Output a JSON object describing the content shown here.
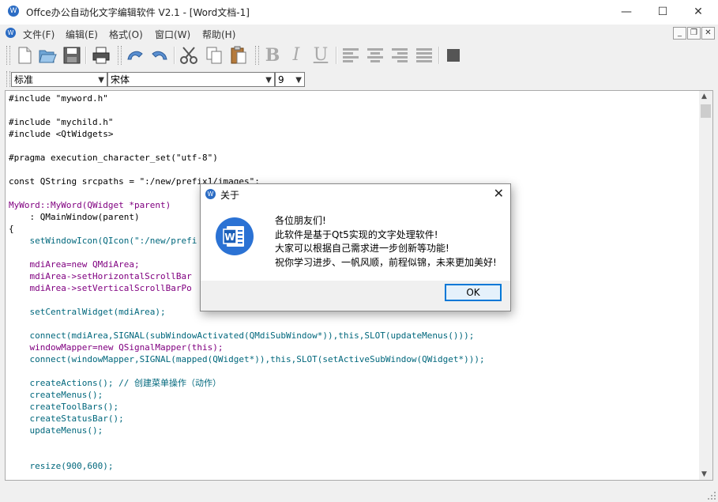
{
  "window": {
    "title": "Offce办公自动化文字编辑软件 V2.1 - [Word文档-1]",
    "minimize": "—",
    "maximize": "☐",
    "close": "✕",
    "app_icon": "app-logo-icon"
  },
  "menubar": {
    "items": [
      "文件(F)",
      "编辑(E)",
      "格式(O)",
      "窗口(W)",
      "帮助(H)"
    ],
    "mdi_min": "_",
    "mdi_restore": "❐",
    "mdi_close": "✕"
  },
  "toolbar": {
    "buttons": [
      "new-file-icon",
      "open-file-icon",
      "save-icon",
      "print-icon",
      "undo-icon",
      "redo-icon",
      "cut-icon",
      "copy-icon",
      "paste-icon",
      "bold-icon",
      "italic-icon",
      "underline-icon",
      "align-left-icon",
      "align-center-icon",
      "align-right-icon",
      "justify-icon",
      "color-icon"
    ],
    "bold": "B",
    "italic": "I",
    "underline": "U"
  },
  "format": {
    "style": "标准",
    "font": "宋体",
    "size": "9"
  },
  "code": [
    "#include \"myword.h\"",
    "",
    "#include \"mychild.h\"",
    "#include <QtWidgets>",
    "",
    "#pragma execution_character_set(\"utf-8\")",
    "",
    "const QString srcpaths = \":/new/prefix1/images\";",
    "",
    "MyWord::MyWord(QWidget *parent)",
    "    : QMainWindow(parent)",
    "{",
    "    setWindowIcon(QIcon(\":/new/prefi",
    "",
    "    mdiArea=new QMdiArea;",
    "    mdiArea->setHorizontalScrollBar",
    "    mdiArea->setVerticalScrollBarPo",
    "",
    "    setCentralWidget(mdiArea);",
    "",
    "    connect(mdiArea,SIGNAL(subWindowActivated(QMdiSubWindow*)),this,SLOT(updateMenus()));",
    "    windowMapper=new QSignalMapper(this);",
    "    connect(windowMapper,SIGNAL(mapped(QWidget*)),this,SLOT(setActiveSubWindow(QWidget*)));",
    "",
    "    createActions(); // 创建菜单操作（动作）",
    "    createMenus();",
    "    createToolBars();",
    "    createStatusBar();",
    "    updateMenus();",
    "",
    "",
    "    resize(900,600);"
  ],
  "dialog": {
    "title": "关于",
    "lines": [
      "各位朋友们!",
      "此软件是基于Qt5实现的文字处理软件!",
      "大家可以根据自己需求进一步创新等功能!",
      "祝你学习进步、一帆风顺，前程似锦，未来更加美好!"
    ],
    "ok_label": "OK",
    "close": "✕",
    "icon_letter": "W"
  },
  "colors": {
    "accent": "#0078d7",
    "icon_blue": "#2b6cc4",
    "keyword": "#808000",
    "type": "#800080",
    "string": "#008000",
    "function": "#00677c"
  }
}
